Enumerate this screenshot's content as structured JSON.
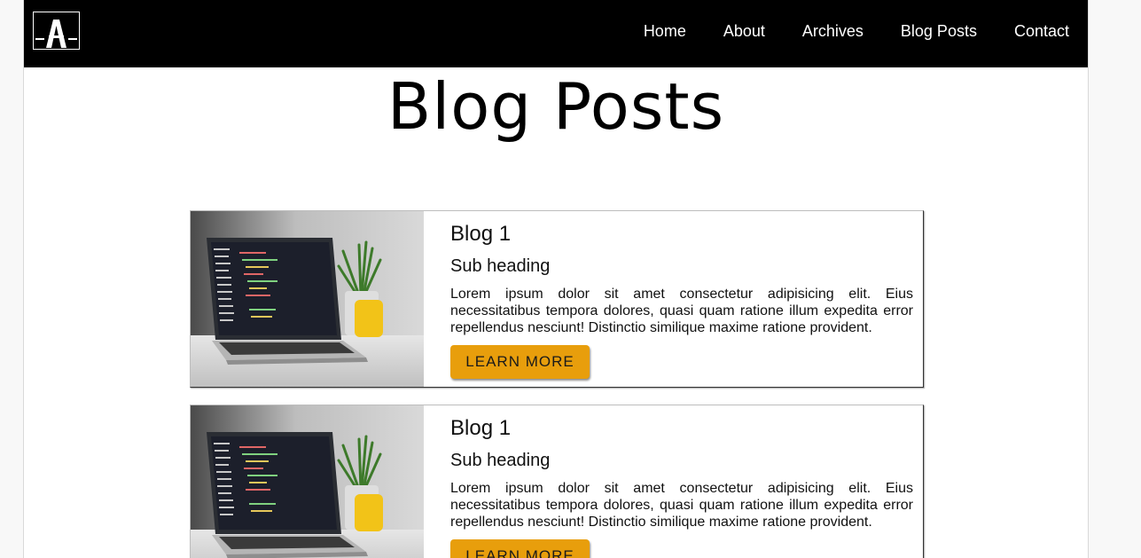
{
  "nav": {
    "logo_icon": "letter-a-logo-icon",
    "links": [
      "Home",
      "About",
      "Archives",
      "Blog Posts",
      "Contact"
    ]
  },
  "page": {
    "title": "Blog Posts"
  },
  "posts": [
    {
      "image_icon": "laptop-plant-photo",
      "title": "Blog 1",
      "subheading": "Sub heading",
      "text": "Lorem ipsum dolor sit amet consectetur adipisicing elit. Eius necessitatibus tempora dolores, quasi quam ratione illum expedita error repellendus nesciunt! Distinctio similique maxime ratione provident.",
      "button": "LEARN MORE"
    },
    {
      "image_icon": "laptop-plant-photo",
      "title": "Blog 1",
      "subheading": "Sub heading",
      "text": "Lorem ipsum dolor sit amet consectetur adipisicing elit. Eius necessitatibus tempora dolores, quasi quam ratione illum expedita error repellendus nesciunt! Distinctio similique maxime ratione provident.",
      "button": "LEARN MORE"
    }
  ],
  "colors": {
    "navbar_bg": "#000000",
    "button_bg": "#e89e0c",
    "text": "#111111"
  }
}
